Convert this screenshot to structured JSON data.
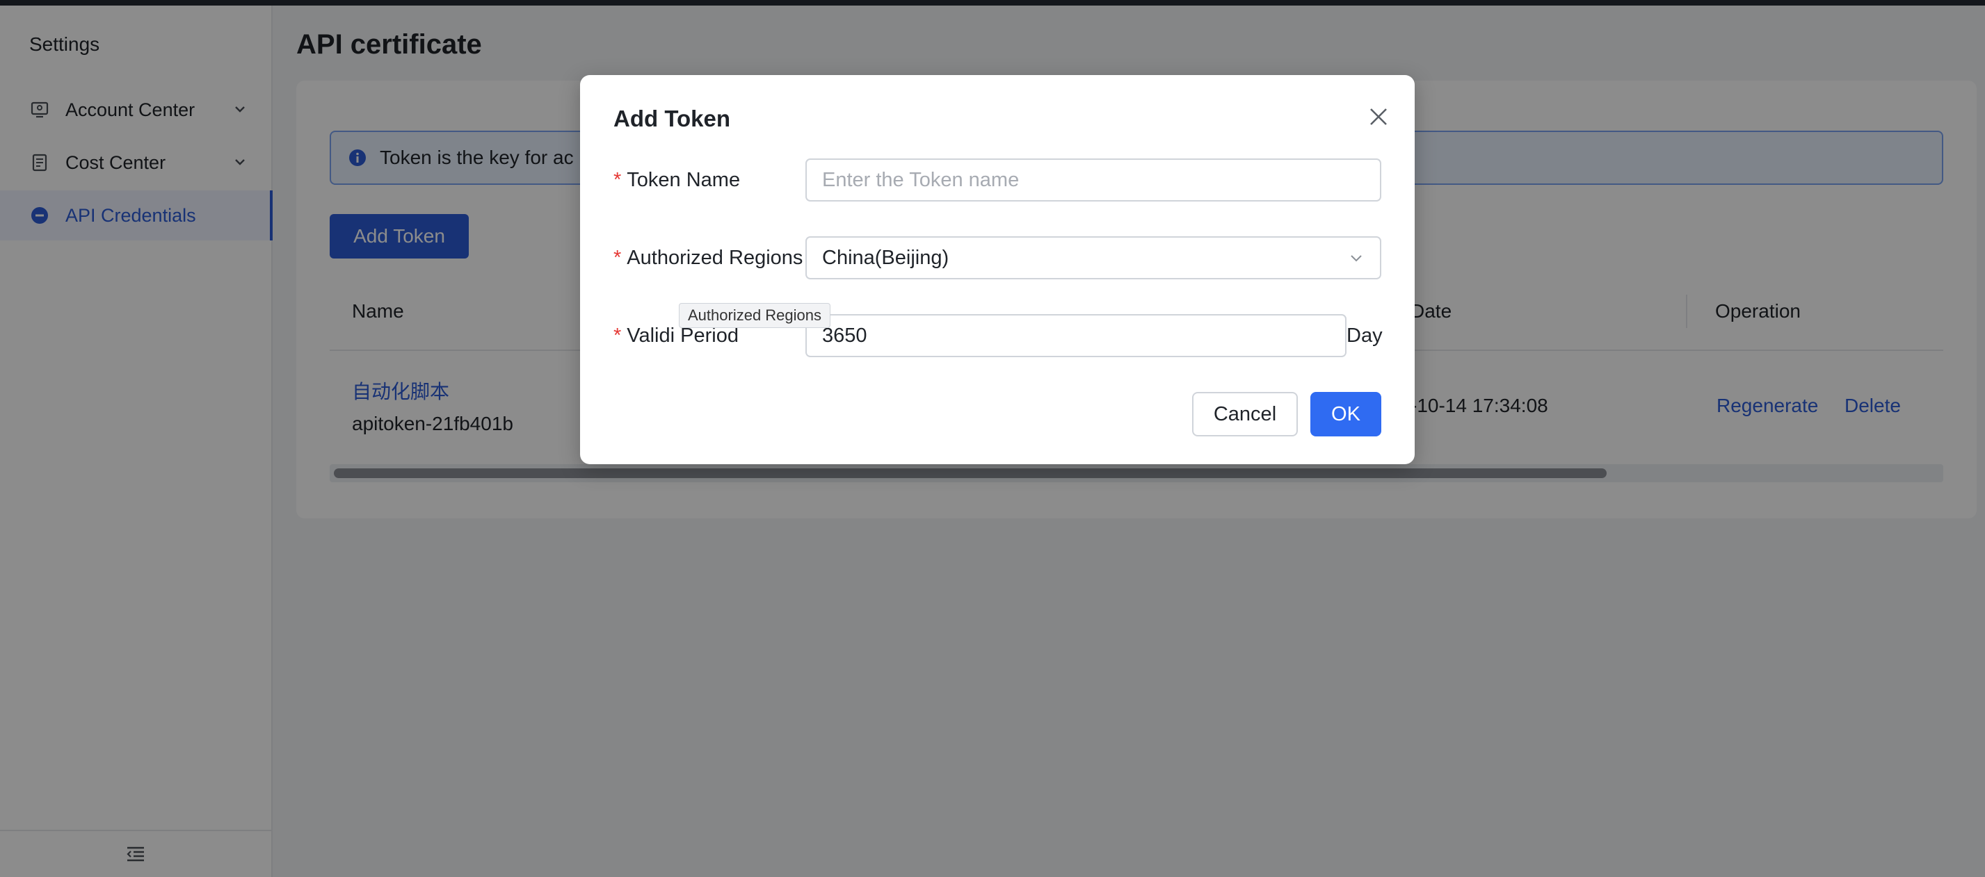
{
  "sidebar": {
    "title": "Settings",
    "items": [
      {
        "label": "Account Center",
        "icon": "monitor-user-icon",
        "expandable": true
      },
      {
        "label": "Cost Center",
        "icon": "document-list-icon",
        "expandable": true
      },
      {
        "label": "API Credentials",
        "icon": "key-circle-icon",
        "active": true
      }
    ],
    "collapse_icon": "menu-collapse-icon"
  },
  "page": {
    "title": "API certificate",
    "info_text": "Token is the key for ac",
    "add_token_label": "Add Token",
    "table": {
      "columns": [
        "Name",
        "Date",
        "Operation"
      ],
      "rows": [
        {
          "name": "自动化脚本",
          "id": "apitoken-21fb401b",
          "date": "-10-14 17:34:08",
          "actions": [
            "Regenerate",
            "Delete"
          ]
        }
      ]
    }
  },
  "modal": {
    "title": "Add Token",
    "fields": {
      "token_name": {
        "label": "Token Name",
        "placeholder": "Enter the Token name",
        "value": ""
      },
      "regions": {
        "label": "Authorized Regions",
        "value": "China(Beijing)"
      },
      "period": {
        "label": "Validi Period",
        "value": "3650",
        "suffix": "Day"
      }
    },
    "tooltip": "Authorized Regions",
    "cancel_label": "Cancel",
    "ok_label": "OK"
  },
  "colors": {
    "accent": "#2c5bd6",
    "ok_button": "#2f6bf2",
    "required": "#e53935"
  }
}
